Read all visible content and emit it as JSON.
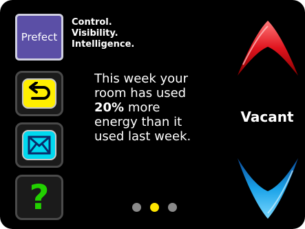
{
  "brand": {
    "logo_text": "Prefect",
    "tagline": [
      "Control.",
      "Visibility.",
      "Intelligence."
    ]
  },
  "buttons": {
    "back_icon": "back-arrow-icon",
    "mail_icon": "envelope-icon",
    "help_label": "?"
  },
  "message": {
    "line1": "This week your",
    "line2": "room has used",
    "percent": "20%",
    "line3_rest": " more",
    "line4": "energy than it",
    "line5": "used last week."
  },
  "status": {
    "occupancy": "Vacant"
  },
  "pager": {
    "count": 3,
    "active_index": 1
  },
  "colors": {
    "accent_up": "#e0141e",
    "accent_down": "#1aa2e8",
    "back_tile": "#ffef00",
    "mail_tile": "#00d8ef",
    "help": "#22d100",
    "active_dot": "#ffe600"
  }
}
